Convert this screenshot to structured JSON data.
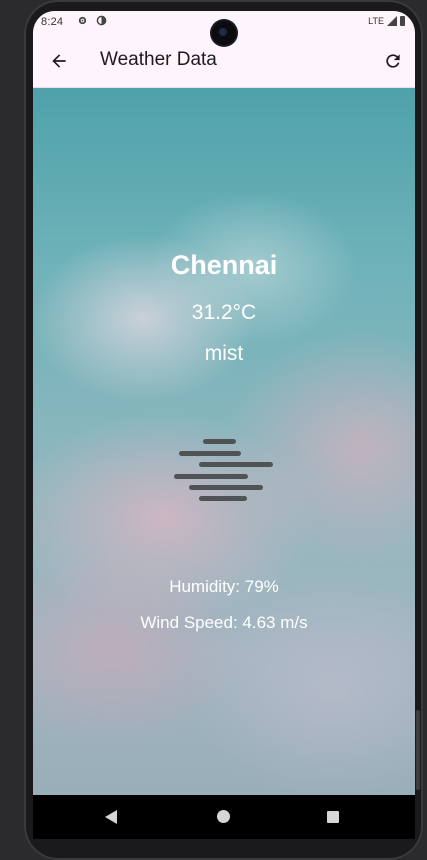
{
  "status_bar": {
    "time": "8:24",
    "network": "LTE",
    "icons": [
      "settings-gear-icon",
      "sync-icon",
      "signal-icon",
      "battery-icon"
    ]
  },
  "app_bar": {
    "title": "Weather Data",
    "back_icon": "arrow-left-icon",
    "refresh_icon": "refresh-icon",
    "background": "#fdf5fb"
  },
  "weather": {
    "city": "Chennai",
    "temperature": "31.2°C",
    "description": "mist",
    "icon": "mist-icon",
    "humidity": "Humidity: 79%",
    "wind_speed": "Wind Speed: 4.63 m/s"
  },
  "nav_bar": {
    "buttons": [
      "back-triangle-icon",
      "home-circle-icon",
      "recents-square-icon"
    ]
  },
  "colors": {
    "text_on_sky": "#ffffff",
    "mist_icon": "#505356",
    "sky_top": "#4fa2aa",
    "nav_bar": "#000000"
  }
}
